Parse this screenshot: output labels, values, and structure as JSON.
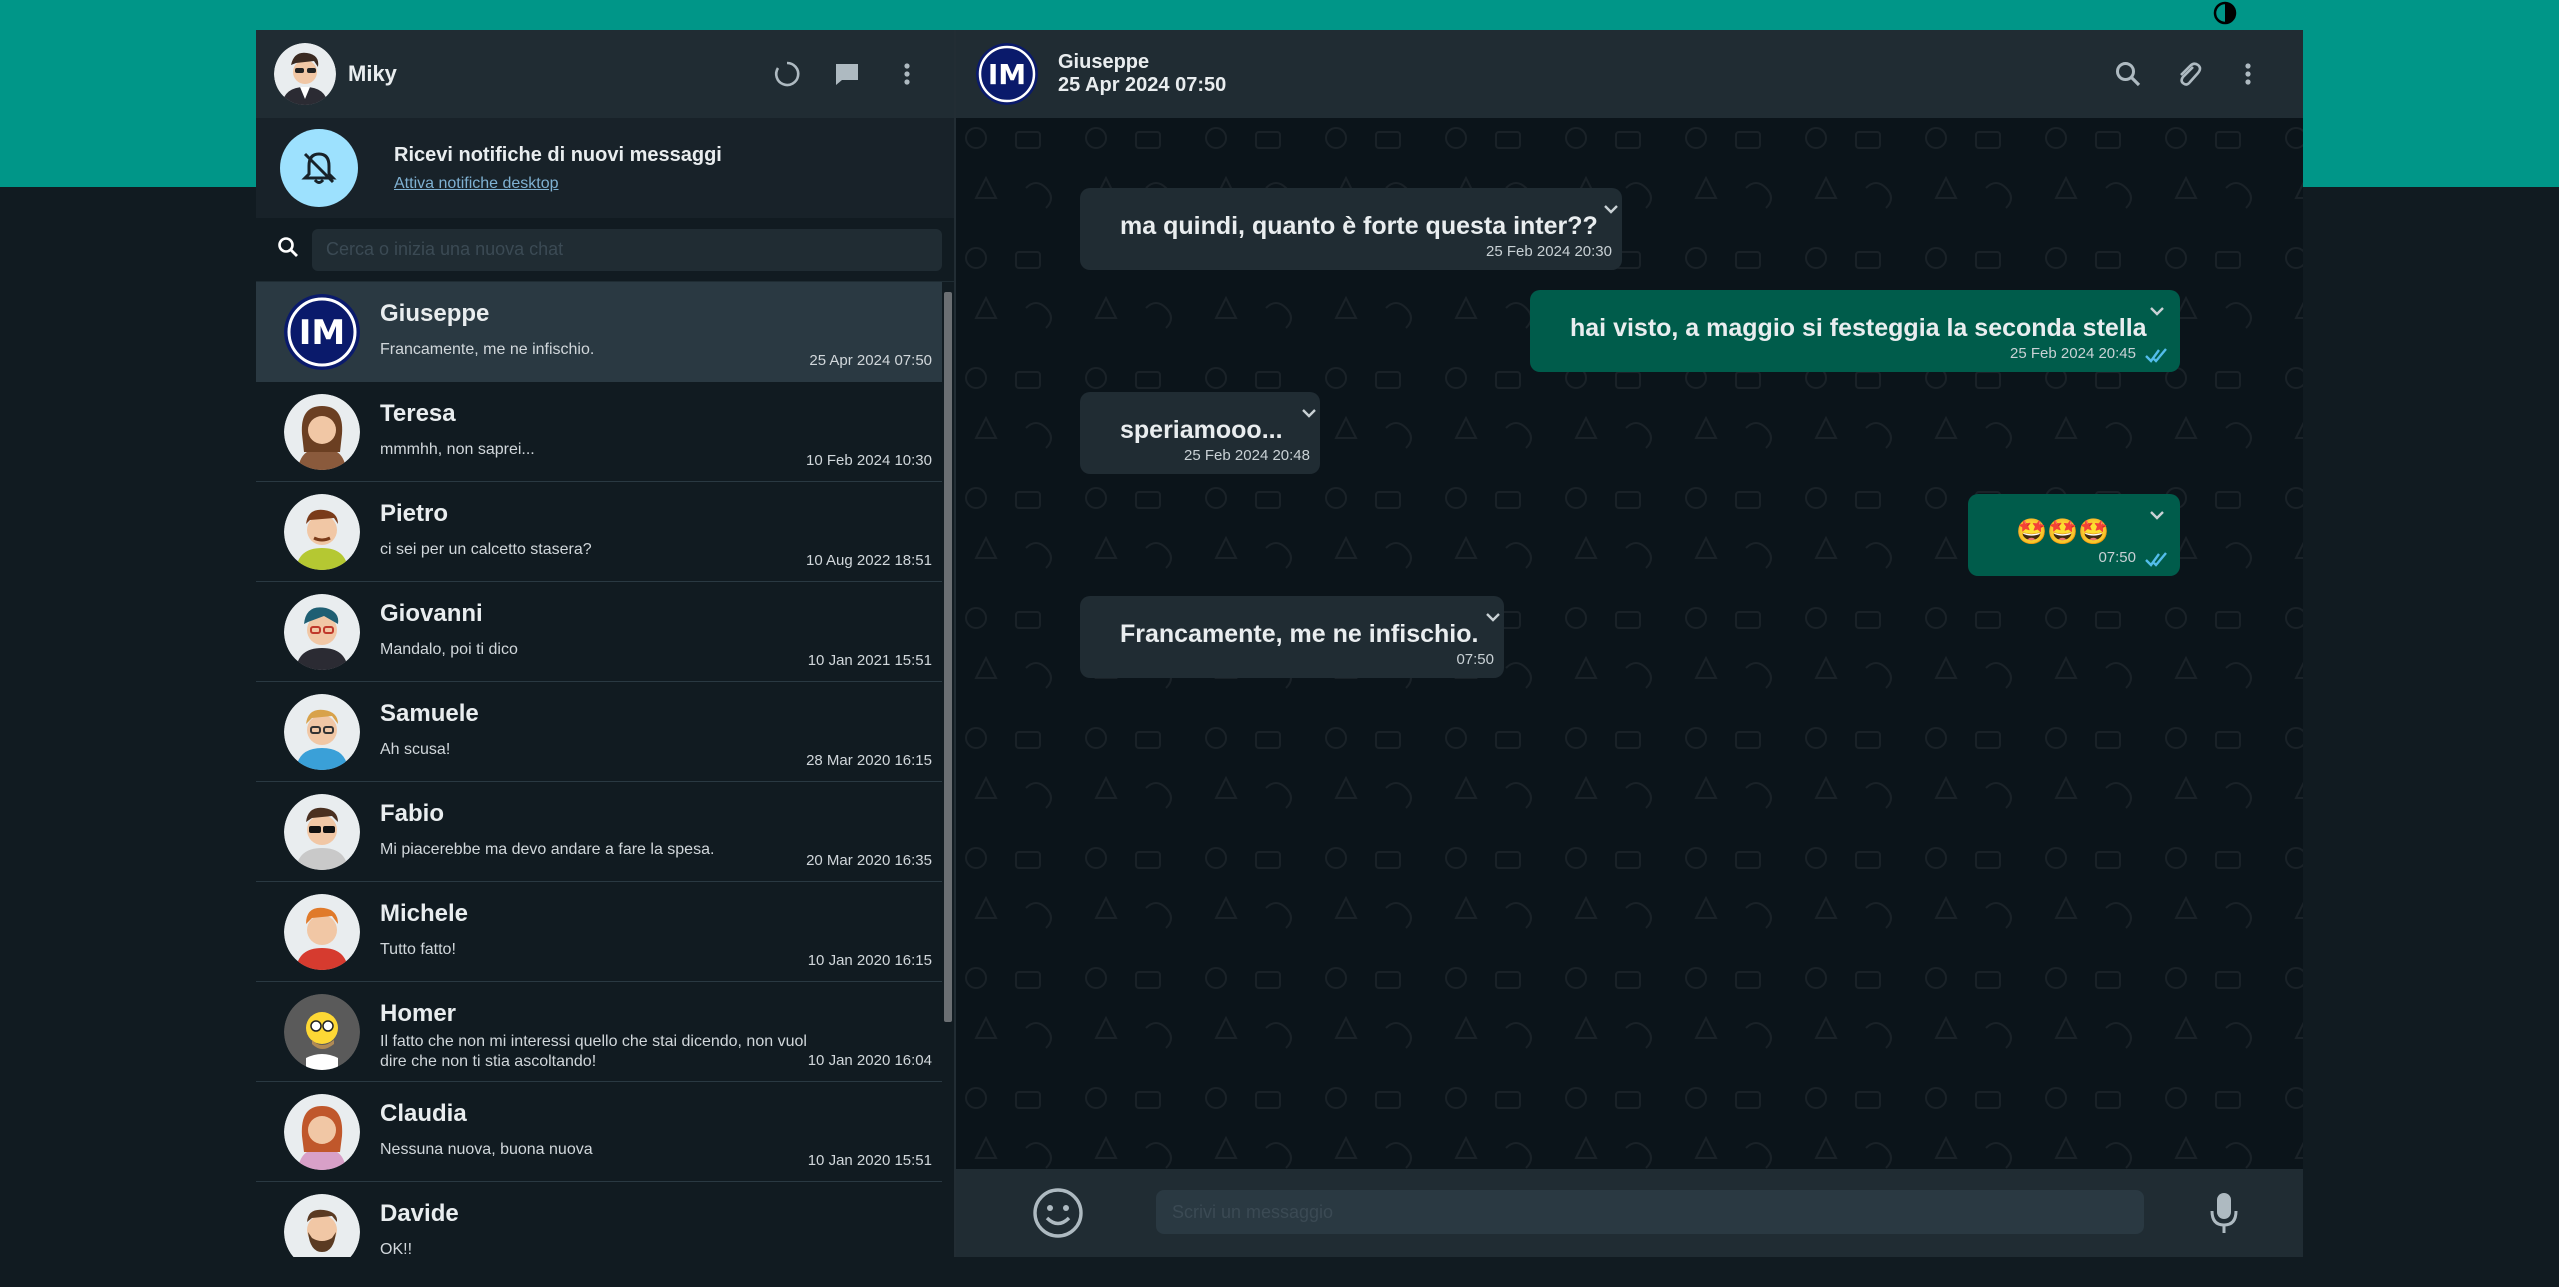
{
  "colors": {
    "accent": "#009688",
    "background": "#111b21",
    "panel": "#202c33",
    "outgoing_bubble": "#005c4b",
    "incoming_bubble": "#202c33",
    "check_read": "#53bdeb"
  },
  "theme_toggle": {
    "icon": "contrast-icon"
  },
  "sidebar": {
    "user": {
      "name": "Miky",
      "avatar": "user-avatar"
    },
    "header_icons": [
      "status-icon",
      "new-chat-icon",
      "menu-dots-icon"
    ],
    "notification": {
      "title": "Ricevi notifiche di nuovi messaggi",
      "link": "Attiva notifiche desktop",
      "icon": "bell-off-icon"
    },
    "search": {
      "placeholder": "Cerca o inizia una nuova chat",
      "value": ""
    },
    "chats": [
      {
        "name": "Giuseppe",
        "preview": "Francamente, me ne infischio.",
        "time": "25 Apr 2024 07:50",
        "active": true
      },
      {
        "name": "Teresa",
        "preview": "mmmhh, non saprei...",
        "time": "10 Feb 2024 10:30"
      },
      {
        "name": "Pietro",
        "preview": "ci sei per un calcetto stasera?",
        "time": "10 Aug 2022 18:51"
      },
      {
        "name": "Giovanni",
        "preview": "Mandalo, poi ti dico",
        "time": "10 Jan 2021 15:51"
      },
      {
        "name": "Samuele",
        "preview": "Ah scusa!",
        "time": "28 Mar 2020 16:15"
      },
      {
        "name": "Fabio",
        "preview": "Mi piacerebbe ma devo andare a fare la spesa.",
        "time": "20 Mar 2020 16:35"
      },
      {
        "name": "Michele",
        "preview": "Tutto fatto!",
        "time": "10 Jan 2020 16:15"
      },
      {
        "name": "Homer",
        "preview": "Il fatto che non mi interessi quello che stai dicendo, non vuol dire che non ti stia ascoltando!",
        "time": "10 Jan 2020 16:04"
      },
      {
        "name": "Claudia",
        "preview": "Nessuna nuova, buona nuova",
        "time": "10 Jan 2020 15:51"
      },
      {
        "name": "Davide",
        "preview": "OK!!",
        "time": ""
      }
    ]
  },
  "conversation": {
    "contact": {
      "name": "Giuseppe",
      "status": "25 Apr 2024 07:50"
    },
    "header_icons": [
      "search-icon",
      "attach-icon",
      "menu-dots-icon"
    ],
    "messages": [
      {
        "direction": "in",
        "text": "ma quindi, quanto è forte questa inter??",
        "time": "25 Feb 2024 20:30"
      },
      {
        "direction": "out",
        "text": "hai visto, a maggio si festeggia la seconda stella",
        "time": "25 Feb 2024 20:45",
        "status": "read"
      },
      {
        "direction": "in",
        "text": "speriamooo...",
        "time": "25 Feb 2024 20:48"
      },
      {
        "direction": "out",
        "text": "🤩🤩🤩",
        "time": "07:50",
        "status": "read"
      },
      {
        "direction": "in",
        "text": "Francamente, me ne infischio.",
        "time": "07:50"
      }
    ]
  },
  "composer": {
    "placeholder": "Scrivi un messaggio",
    "value": "",
    "left_icon": "emoji-icon",
    "right_icon": "mic-icon"
  }
}
